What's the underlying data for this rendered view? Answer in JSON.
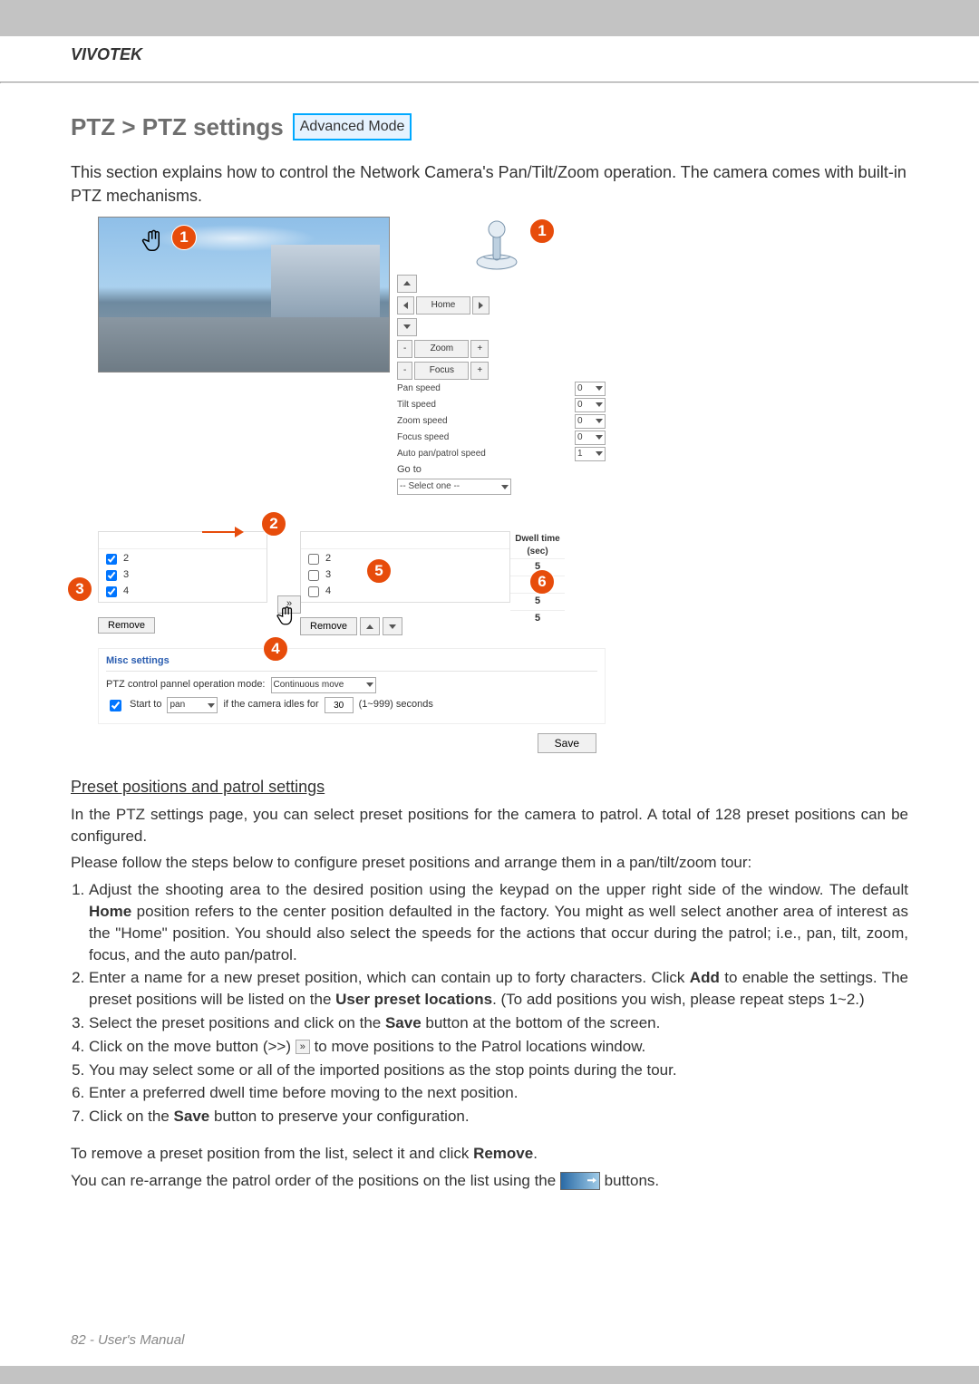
{
  "brand": "VIVOTEK",
  "title": "PTZ > PTZ settings",
  "badge": "Advanced Mode",
  "intro": "This section explains how to control the Network Camera's Pan/Tilt/Zoom operation. The camera comes with built-in PTZ mechanisms.",
  "controls": {
    "home": "Home",
    "zoom": "Zoom",
    "focus": "Focus",
    "pan_speed": "Pan speed",
    "tilt_speed": "Tilt speed",
    "zoom_speed": "Zoom speed",
    "focus_speed": "Focus speed",
    "auto_patrol": "Auto pan/patrol speed",
    "goto": "Go to",
    "select_one": "-- Select one --",
    "speed_val0": "0",
    "speed_val1": "1"
  },
  "left_rows": [
    "2",
    "3",
    "4"
  ],
  "right_rows": [
    "2",
    "3",
    "4"
  ],
  "dwell_header1": "Dwell time",
  "dwell_header2": "(sec)",
  "dwell_vals": [
    "5",
    "5",
    "5",
    "5"
  ],
  "remove": "Remove",
  "misc": {
    "title": "Misc settings",
    "label_mode": "PTZ control pannel operation mode:",
    "mode_value": "Continuous move",
    "start_to": "Start to",
    "pan": "pan",
    "idle_label": "if the camera idles for",
    "idle_val": "30",
    "idle_units": "(1~999) seconds"
  },
  "save": "Save",
  "section_head": "Preset positions and patrol settings",
  "para1": "In the PTZ settings page, you can select preset positions for the camera to patrol. A total of 128 preset positions can be configured.",
  "para2": "Please follow the steps below to configure preset positions and arrange them in a pan/tilt/zoom tour:",
  "steps": {
    "s1a": "Adjust the shooting area to the desired position using the keypad on the upper right side of the window. The  default ",
    "s1b": "Home",
    "s1c": " position refers to the center position defaulted in the factory. You might as well select another area of interest as the \"Home\" position. You should also select the speeds for the actions that occur during the patrol; i.e., pan, tilt, zoom, focus, and the auto pan/patrol.",
    "s2a": "Enter a name for a new preset position, which can contain up to forty characters. Click ",
    "s2b": "Add",
    "s2c": " to enable the settings. The preset positions will be listed on the ",
    "s2d": "User preset locations",
    "s2e": ". (To add positions you wish, please repeat steps 1~2.)",
    "s3a": "Select the preset positions and click on the ",
    "s3b": "Save",
    "s3c": " button at the bottom of the screen.",
    "s4a": "Click on the move button (>>) ",
    "s4b": " to move positions to the Patrol locations window.",
    "s5": "You may select some or all of the imported positions as the stop points during the tour.",
    "s6": "Enter a preferred dwell time before moving to the next position.",
    "s7a": "Click on the ",
    "s7b": "Save",
    "s7c": " button to preserve your configuration."
  },
  "remove_para_a": "To remove a preset position from the list, select it and click ",
  "remove_para_b": "Remove",
  "remove_para_c": ".",
  "reorder_a": "You can re-arrange the patrol order of the positions on the list using the ",
  "reorder_b": " buttons.",
  "footer": "82 - User's Manual"
}
